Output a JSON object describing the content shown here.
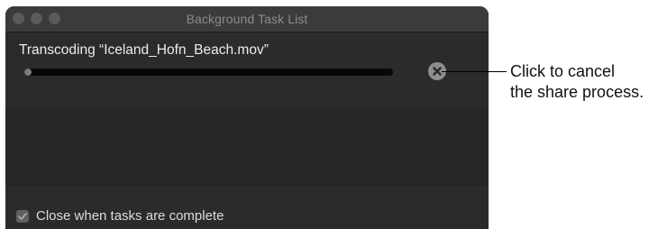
{
  "window": {
    "title": "Background Task List",
    "traffic_lights": [
      "close",
      "minimize",
      "zoom"
    ]
  },
  "task": {
    "label": "Transcoding “Iceland_Hofn_Beach.mov”",
    "progress": 0.02,
    "cancel_icon": "close-circle-icon"
  },
  "footer": {
    "checkbox_checked": true,
    "checkbox_label": "Close when tasks are complete"
  },
  "callout": {
    "line1": "Click to cancel",
    "line2": "the share process."
  },
  "colors": {
    "window_bg": "#262626",
    "titlebar_bg": "#3b3b3b",
    "progress_track": "#080808",
    "progress_fill": "#7a7a7a",
    "cancel_button": "#8e8e8e"
  }
}
